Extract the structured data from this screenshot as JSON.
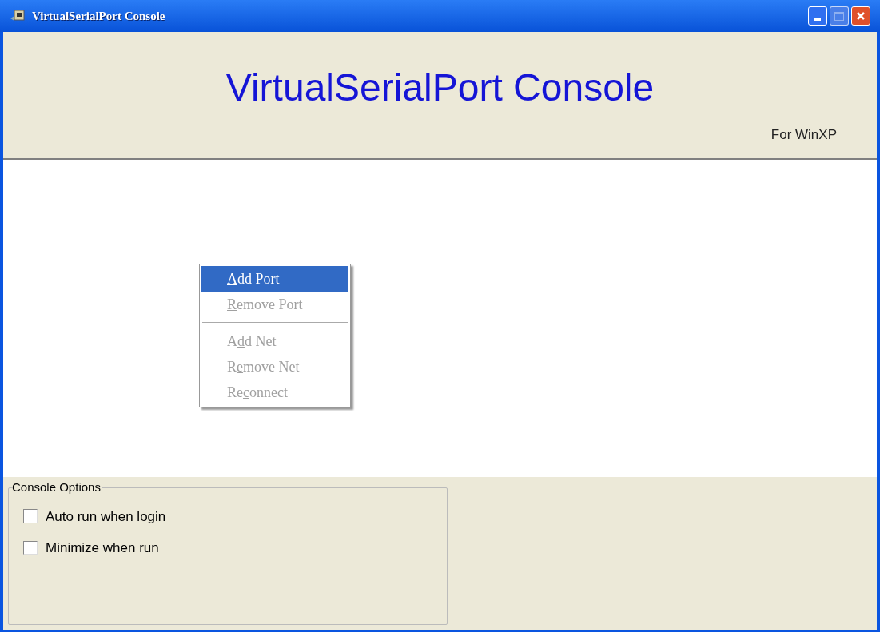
{
  "window": {
    "title": "VirtualSerialPort Console"
  },
  "header": {
    "title": "VirtualSerialPort Console",
    "subtitle": "For WinXP"
  },
  "context_menu": {
    "items": [
      {
        "kind": "item",
        "key": "A",
        "after": "dd Port",
        "selected": true,
        "disabled": false
      },
      {
        "kind": "item",
        "key": "R",
        "after": "emove Port",
        "selected": false,
        "disabled": true
      },
      {
        "kind": "separator"
      },
      {
        "kind": "item",
        "before": "A",
        "key": "d",
        "after": "d Net",
        "selected": false,
        "disabled": true
      },
      {
        "kind": "item",
        "before": "R",
        "key": "e",
        "after": "move Net",
        "selected": false,
        "disabled": true
      },
      {
        "kind": "item",
        "before": "Re",
        "key": "c",
        "after": "onnect",
        "selected": false,
        "disabled": true
      }
    ]
  },
  "options": {
    "title": "Console Options",
    "checkboxes": [
      {
        "label": "Auto run when login",
        "checked": false
      },
      {
        "label": "Minimize when run",
        "checked": false
      }
    ]
  }
}
